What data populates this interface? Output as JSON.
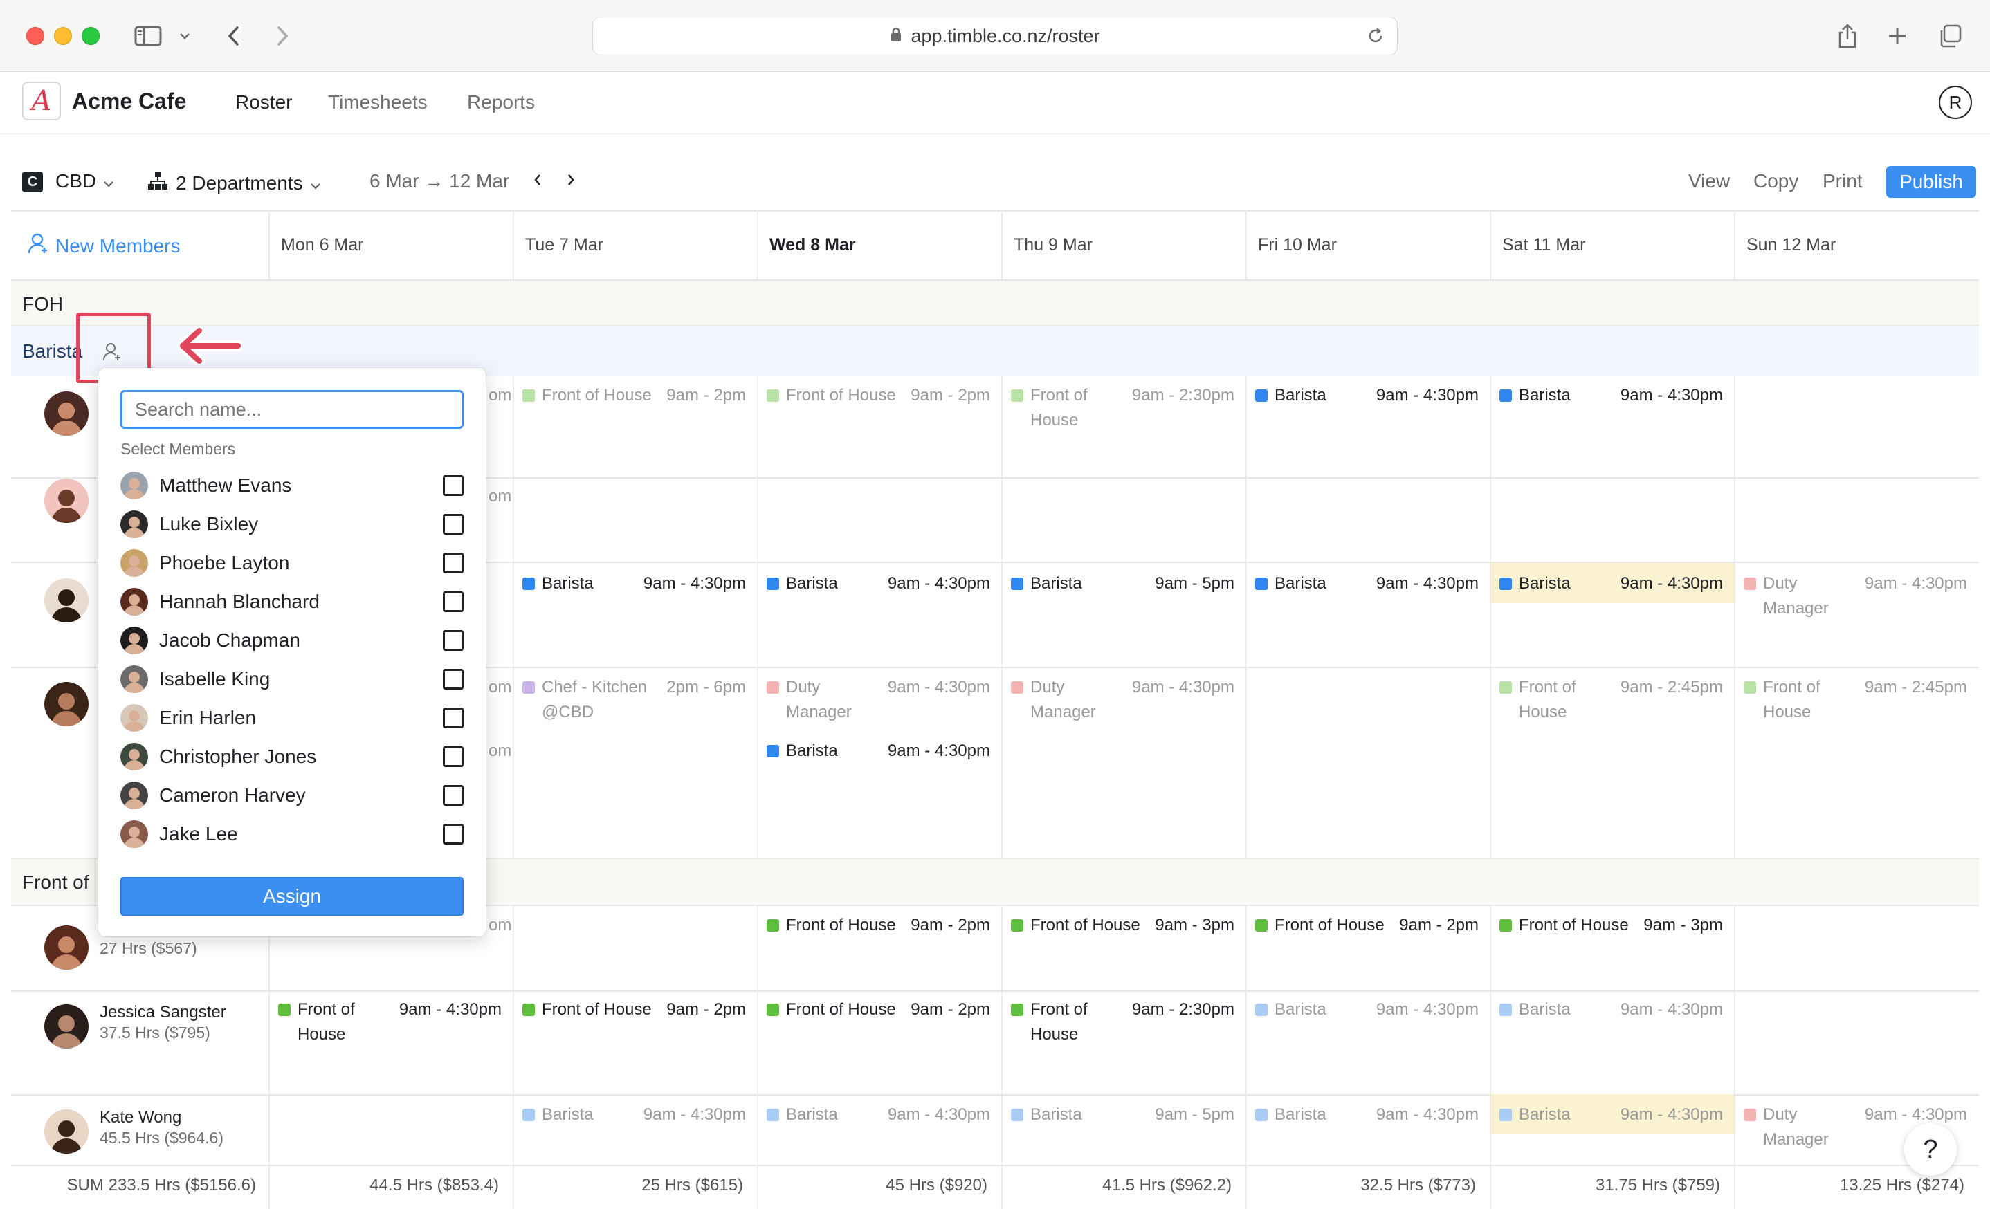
{
  "browser": {
    "url": "app.timble.co.nz/roster"
  },
  "app": {
    "logo_letter": "A",
    "company": "Acme Cafe",
    "nav": [
      "Roster",
      "Timesheets",
      "Reports"
    ],
    "active_nav": "Roster",
    "user_initial": "R"
  },
  "toolbar": {
    "location_badge": "C",
    "location": "CBD",
    "departments": "2 Departments",
    "date_range": "6 Mar → 12 Mar",
    "view": "View",
    "copy": "Copy",
    "print": "Print",
    "publish": "Publish"
  },
  "roster": {
    "new_members": "New Members",
    "days": [
      "Mon 6 Mar",
      "Tue 7 Mar",
      "Wed 8 Mar",
      "Thu 9 Mar",
      "Fri 10 Mar",
      "Sat 11 Mar",
      "Sun 12 Mar"
    ],
    "today_index": 2,
    "dept_foh": "FOH",
    "role_barista": "Barista",
    "dept_front": "Front of",
    "barista_rows": [
      {
        "shifts": [
          {
            "day": 1,
            "role": "Front of House",
            "time": "9am - 2pm",
            "color": "#b9e3a6",
            "style": "dim"
          },
          {
            "day": 2,
            "role": "Front of House",
            "time": "9am - 2pm",
            "color": "#b9e3a6",
            "style": "dim"
          },
          {
            "day": 3,
            "role": "Front of",
            "role2": "House",
            "time": "9am - 2:30pm",
            "color": "#b9e3a6",
            "style": "dim"
          },
          {
            "day": 4,
            "role": "Barista",
            "time": "9am - 4:30pm",
            "color": "#2f86ef",
            "style": "solid"
          },
          {
            "day": 5,
            "role": "Barista",
            "time": "9am - 4:30pm",
            "color": "#2f86ef",
            "style": "solid"
          }
        ]
      },
      {
        "shifts": []
      },
      {
        "shifts": [
          {
            "day": 1,
            "role": "Barista",
            "time": "9am - 4:30pm",
            "color": "#2f86ef",
            "style": "solid"
          },
          {
            "day": 2,
            "role": "Barista",
            "time": "9am - 4:30pm",
            "color": "#2f86ef",
            "style": "solid"
          },
          {
            "day": 3,
            "role": "Barista",
            "time": "9am - 5pm",
            "color": "#2f86ef",
            "style": "solid"
          },
          {
            "day": 4,
            "role": "Barista",
            "time": "9am - 4:30pm",
            "color": "#2f86ef",
            "style": "solid"
          },
          {
            "day": 5,
            "role": "Barista",
            "time": "9am - 4:30pm",
            "color": "#2f86ef",
            "style": "solid",
            "highlight": true
          },
          {
            "day": 6,
            "role": "Duty",
            "role2": "Manager",
            "time": "9am - 4:30pm",
            "color": "#f4b4b4",
            "style": "dim"
          }
        ]
      },
      {
        "shifts": [
          {
            "day": 1,
            "role": "Chef - Kitchen",
            "role2": "@CBD",
            "time": "2pm - 6pm",
            "color": "#c9b4ea",
            "style": "dim"
          },
          {
            "day": 2,
            "role": "Duty",
            "role2": "Manager",
            "time": "9am - 4:30pm",
            "color": "#f4b4b4",
            "style": "dim"
          },
          {
            "day": 2,
            "offset": 1,
            "role": "Barista",
            "time": "9am - 4:30pm",
            "color": "#2f86ef",
            "style": "solid"
          },
          {
            "day": 3,
            "role": "Duty",
            "role2": "Manager",
            "time": "9am - 4:30pm",
            "color": "#f4b4b4",
            "style": "dim"
          },
          {
            "day": 5,
            "role": "Front of",
            "role2": "House",
            "time": "9am - 2:45pm",
            "color": "#b9e3a6",
            "style": "dim"
          },
          {
            "day": 6,
            "role": "Front of",
            "role2": "House",
            "time": "9am - 2:45pm",
            "color": "#b9e3a6",
            "style": "dim"
          }
        ]
      }
    ],
    "front_rows": [
      {
        "name": "Hannah Blanchard",
        "hours": "27 Hrs ($567)",
        "shifts": [
          {
            "day": 2,
            "role": "Front of House",
            "time": "9am - 2pm",
            "color": "#5fbf3c",
            "style": "solid"
          },
          {
            "day": 3,
            "role": "Front of House",
            "time": "9am - 3pm",
            "color": "#5fbf3c",
            "style": "solid"
          },
          {
            "day": 4,
            "role": "Front of House",
            "time": "9am - 2pm",
            "color": "#5fbf3c",
            "style": "solid"
          },
          {
            "day": 5,
            "role": "Front of House",
            "time": "9am - 3pm",
            "color": "#5fbf3c",
            "style": "solid"
          }
        ]
      },
      {
        "name": "Jessica Sangster",
        "hours": "37.5 Hrs ($795)",
        "shifts": [
          {
            "day": 0,
            "role": "Front of",
            "role2": "House",
            "time": "9am - 4:30pm",
            "color": "#5fbf3c",
            "style": "solid"
          },
          {
            "day": 1,
            "role": "Front of House",
            "time": "9am - 2pm",
            "color": "#5fbf3c",
            "style": "solid"
          },
          {
            "day": 2,
            "role": "Front of House",
            "time": "9am - 2pm",
            "color": "#5fbf3c",
            "style": "solid"
          },
          {
            "day": 3,
            "role": "Front of",
            "role2": "House",
            "time": "9am - 2:30pm",
            "color": "#5fbf3c",
            "style": "solid"
          },
          {
            "day": 4,
            "role": "Barista",
            "time": "9am - 4:30pm",
            "color": "#a9cdf5",
            "style": "dim"
          },
          {
            "day": 5,
            "role": "Barista",
            "time": "9am - 4:30pm",
            "color": "#a9cdf5",
            "style": "dim"
          }
        ]
      },
      {
        "name": "Kate Wong",
        "hours": "45.5 Hrs ($964.6)",
        "shifts": [
          {
            "day": 1,
            "role": "Barista",
            "time": "9am - 4:30pm",
            "color": "#a9cdf5",
            "style": "dim"
          },
          {
            "day": 2,
            "role": "Barista",
            "time": "9am - 4:30pm",
            "color": "#a9cdf5",
            "style": "dim"
          },
          {
            "day": 3,
            "role": "Barista",
            "time": "9am - 5pm",
            "color": "#a9cdf5",
            "style": "dim"
          },
          {
            "day": 4,
            "role": "Barista",
            "time": "9am - 4:30pm",
            "color": "#a9cdf5",
            "style": "dim"
          },
          {
            "day": 5,
            "role": "Barista",
            "time": "9am - 4:30pm",
            "color": "#a9cdf5",
            "style": "dim",
            "highlight": true
          },
          {
            "day": 6,
            "role": "Duty",
            "role2": "Manager",
            "time": "9am - 4:30pm",
            "color": "#f4b4b4",
            "style": "dim"
          }
        ]
      }
    ],
    "partial_times": [
      "om",
      "om",
      "om",
      "om",
      "om"
    ],
    "sum_label": "SUM 233.5 Hrs ($5156.6)",
    "sums": [
      "44.5 Hrs ($853.4)",
      "25 Hrs ($615)",
      "45 Hrs ($920)",
      "41.5 Hrs ($962.2)",
      "32.5 Hrs ($773)",
      "31.75 Hrs ($759)",
      "13.25 Hrs ($274)"
    ]
  },
  "popup": {
    "search_placeholder": "Search name...",
    "subtitle": "Select Members",
    "members": [
      "Matthew Evans",
      "Luke Bixley",
      "Phoebe Layton",
      "Hannah Blanchard",
      "Jacob Chapman",
      "Isabelle King",
      "Erin Harlen",
      "Christopher Jones",
      "Cameron Harvey",
      "Jake Lee"
    ],
    "assign": "Assign"
  },
  "help": "?"
}
